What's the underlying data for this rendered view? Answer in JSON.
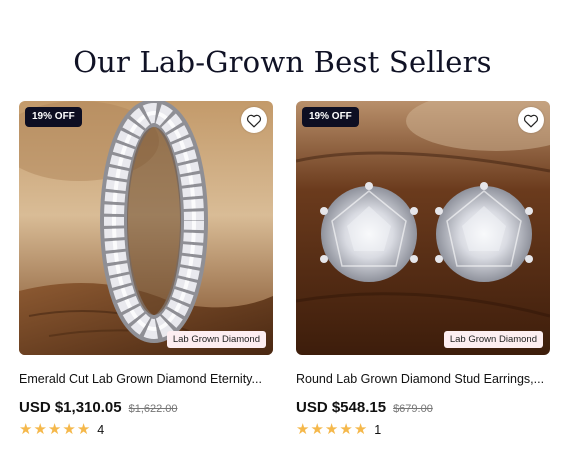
{
  "section": {
    "title": "Our Lab-Grown Best Sellers"
  },
  "products": [
    {
      "discount": "19% OFF",
      "tag": "Lab Grown Diamond",
      "title": "Emerald Cut Lab Grown Diamond Eternity...",
      "price": "USD $1,310.05",
      "old_price": "$1,622.00",
      "rating": 5,
      "reviews": "4",
      "image": "emerald-cut-eternity-ring-photo"
    },
    {
      "discount": "19% OFF",
      "tag": "Lab Grown Diamond",
      "title": "Round Lab Grown Diamond Stud Earrings,...",
      "price": "USD $548.15",
      "old_price": "$679.00",
      "rating": 5,
      "reviews": "1",
      "image": "round-diamond-stud-earrings-photo"
    }
  ],
  "colors": {
    "badge_bg": "#0d0e22",
    "tag_bg": "#fdeef1",
    "star": "#f5b84b"
  },
  "icons": {
    "wishlist": "heart-icon",
    "rating": "star-icon"
  }
}
